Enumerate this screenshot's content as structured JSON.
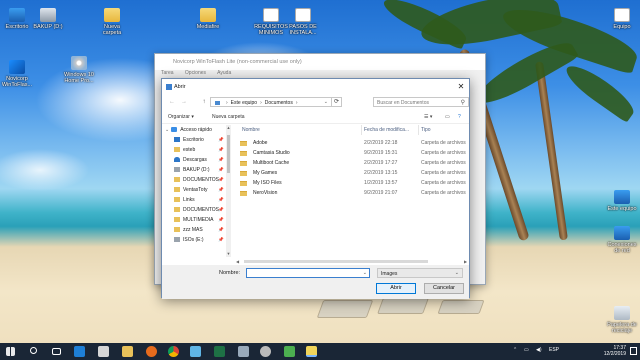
{
  "desktop": {
    "icons": [
      {
        "label": "Escritorio",
        "icon": "folder-blue-icon"
      },
      {
        "label": "BAKUP (D:)",
        "icon": "drive-icon"
      },
      {
        "label": "Nueva carpeta",
        "icon": "folder-icon"
      },
      {
        "label": "Mediafire",
        "icon": "folder-icon"
      },
      {
        "label": "REQUISITOS MINIMOS",
        "icon": "document-icon"
      },
      {
        "label": "PASOS DE INSTALA...",
        "icon": "document-icon"
      },
      {
        "label": "Equipo",
        "icon": "document-icon"
      },
      {
        "label": "Novicorp WinToFlas...",
        "icon": "app-icon"
      },
      {
        "label": "Windows 10 Home Pro...",
        "icon": "disc-icon"
      },
      {
        "label": "Este equipo",
        "icon": "computer-icon"
      },
      {
        "label": "Conexiones de red",
        "icon": "network-icon"
      },
      {
        "label": "Papelera de reciclaje",
        "icon": "recycle-bin-icon"
      }
    ]
  },
  "bg_window": {
    "title": "Novicorp WinToFlash Lite (non-commercial use only)",
    "menu": [
      "Tarea",
      "Opciones",
      "Ayuda"
    ]
  },
  "dialog": {
    "title": "Abrir",
    "close": "✕",
    "nav": {
      "back": "←",
      "forward": "→",
      "up": "↑"
    },
    "address": {
      "root": "Este equipo",
      "folder": "Documentos"
    },
    "search_placeholder": "Buscar en Documentos",
    "toolbar": {
      "organize": "Organizar ▾",
      "new_folder": "Nueva carpeta"
    },
    "nav_pane": [
      {
        "label": "Acceso rápido",
        "icon": "star-icon",
        "pinned": false
      },
      {
        "label": "Escritorio",
        "icon": "desktop-icon",
        "pinned": true
      },
      {
        "label": "esteb",
        "icon": "folder-icon",
        "pinned": true
      },
      {
        "label": "Descargas",
        "icon": "download-icon",
        "pinned": true
      },
      {
        "label": "BAKUP (D:)",
        "icon": "drive-icon",
        "pinned": true
      },
      {
        "label": "DOCUMENTOS",
        "icon": "folder-icon",
        "pinned": true
      },
      {
        "label": "VentasToty",
        "icon": "folder-icon",
        "pinned": true
      },
      {
        "label": "Links",
        "icon": "folder-icon",
        "pinned": true
      },
      {
        "label": "DOCUMENTOS",
        "icon": "folder-icon",
        "pinned": true
      },
      {
        "label": "MULTIMEDIA",
        "icon": "folder-icon",
        "pinned": true
      },
      {
        "label": "zzz MAS",
        "icon": "folder-icon",
        "pinned": true
      },
      {
        "label": "ISOs (E:)",
        "icon": "drive-icon",
        "pinned": true
      }
    ],
    "columns": {
      "name": "Nombre",
      "date": "Fecha de modifica...",
      "type": "Tipo"
    },
    "files": [
      {
        "name": "Adobe",
        "date": "2/2/2019 22:18",
        "type": "Carpeta de archivos"
      },
      {
        "name": "Camtasia Studio",
        "date": "9/2/2019 15:31",
        "type": "Carpeta de archivos"
      },
      {
        "name": "Multiboot Cache",
        "date": "2/2/2019 17:27",
        "type": "Carpeta de archivos"
      },
      {
        "name": "My Games",
        "date": "2/2/2019 13:15",
        "type": "Carpeta de archivos"
      },
      {
        "name": "My ISO Files",
        "date": "1/2/2019 13:57",
        "type": "Carpeta de archivos"
      },
      {
        "name": "NeroVision",
        "date": "9/2/2019 21:07",
        "type": "Carpeta de archivos"
      }
    ],
    "filename_label": "Nombre:",
    "filename_value": "",
    "filter": "Images",
    "open_button": "Abrir",
    "cancel_button": "Cancelar"
  },
  "taskbar": {
    "language": "ESP",
    "time": "17:37",
    "date": "12/2/2019"
  }
}
